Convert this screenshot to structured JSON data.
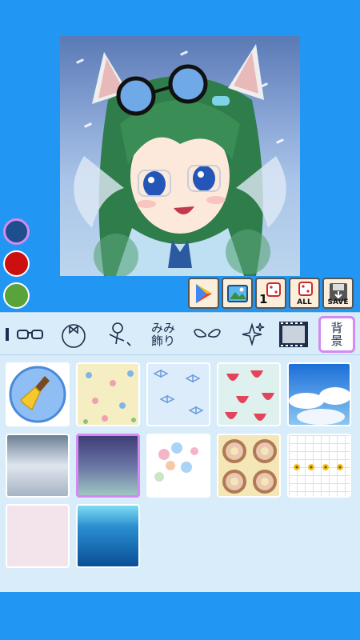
{
  "colors": {
    "accent": "#2196f3",
    "panel": "#d8ecf9",
    "selection": "#d48af2"
  },
  "palette": [
    {
      "name": "dark-blue",
      "hex": "#1f4e8c",
      "selected": true
    },
    {
      "name": "red",
      "hex": "#cc1010",
      "selected": false
    },
    {
      "name": "green",
      "hex": "#5aa33a",
      "selected": false
    }
  ],
  "actions": {
    "random_one_label": "1",
    "random_all_label": "ALL",
    "save_label": "SAVE"
  },
  "tabs": {
    "accessory_label_top": "みみ",
    "accessory_label_bottom": "飾り",
    "background_label_top": "背",
    "background_label_bottom": "景",
    "selected": "background"
  },
  "backgrounds": [
    {
      "icon": "broom-icon",
      "kind": "clear"
    },
    {
      "kind": "floral-cream"
    },
    {
      "kind": "ribbon-blue"
    },
    {
      "kind": "strawberry"
    },
    {
      "kind": "sky-clouds"
    },
    {
      "kind": "gray-gradient"
    },
    {
      "kind": "night-gradient",
      "selected": true
    },
    {
      "kind": "balloons"
    },
    {
      "kind": "donuts"
    },
    {
      "kind": "grid-flowers"
    },
    {
      "kind": "pink-plain"
    },
    {
      "kind": "underwater"
    }
  ]
}
